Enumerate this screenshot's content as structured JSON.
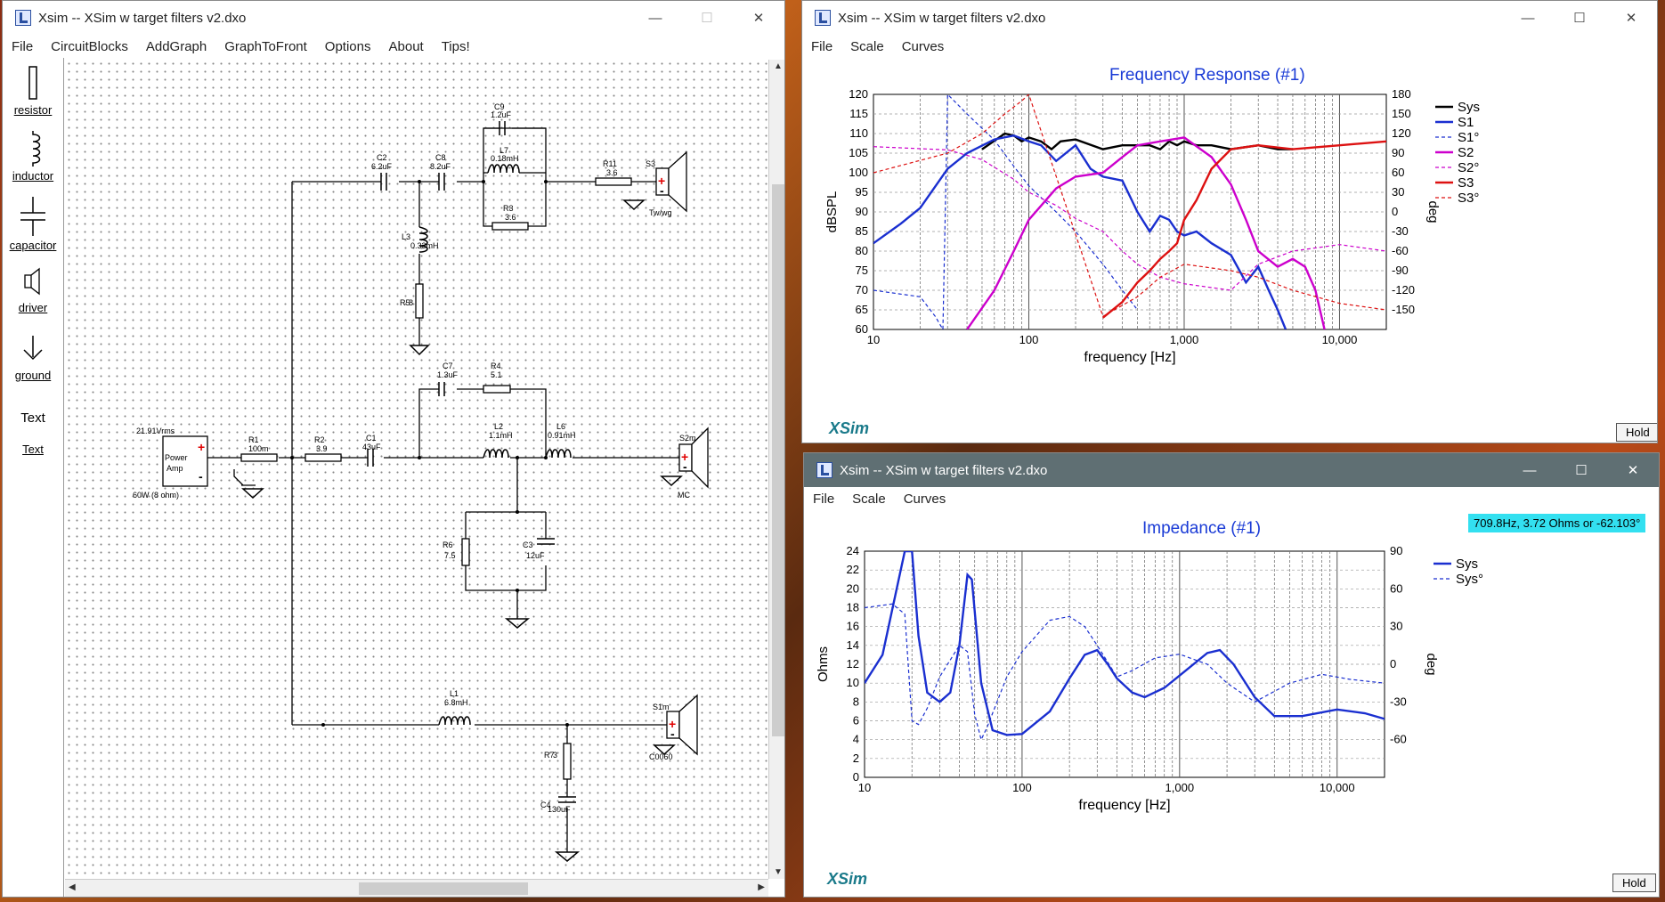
{
  "schematic_window": {
    "title": "Xsim -- XSim w target filters v2.dxo",
    "menu": [
      "File",
      "CircuitBlocks",
      "AddGraph",
      "GraphToFront",
      "Options",
      "About",
      "Tips!"
    ],
    "palette": [
      "resistor",
      "inductor",
      "capacitor",
      "driver",
      "ground",
      "Text",
      "Text"
    ],
    "components": {
      "src_v": "21.91Vrms",
      "src_l1": "Power",
      "src_l2": "Amp",
      "src_w": "60W (8 ohm)",
      "r1": "R1",
      "r1v": "100m",
      "r2": "R2",
      "r2v": "3.9",
      "c1": "C1",
      "c1v": "43uF",
      "c2": "C2",
      "c2v": "6.2uF",
      "c8": "C8",
      "c8v": "8.2uF",
      "c9": "C9",
      "c9v": "1.2uF",
      "l7": "L7",
      "l7v": "0.18mH",
      "r3": "R3",
      "r3v": "3.6",
      "r11": "R11",
      "r11v": "3.6",
      "s3": "S3",
      "s3v": "Tw/wg",
      "l3": "L3",
      "l3v": "0.33mH",
      "r5": "R5",
      "r5v": "8",
      "c7": "C7",
      "c7v": "1.3uF",
      "r4": "R4",
      "r4v": "5.1",
      "l2": "L2",
      "l2v": "1.1mH",
      "l6": "L6",
      "l6v": "0.91mH",
      "s2": "S2m",
      "s2v": "MC",
      "r6": "R6",
      "r6v": "7.5",
      "c3": "C3",
      "c3v": "12uF",
      "l1": "L1",
      "l1v": "6.8mH",
      "s1": "S1m",
      "s1v": "C0060",
      "r7": "R7",
      "r7v": "3",
      "c4": "C4",
      "c4v": "130uF"
    }
  },
  "freq_window": {
    "title": "Xsim -- XSim w target filters v2.dxo",
    "menu": [
      "File",
      "Scale",
      "Curves"
    ],
    "plot_title": "Frequency Response (#1)",
    "brand": "XSim",
    "hold": "Hold"
  },
  "imp_window": {
    "title": "Xsim -- XSim w target filters v2.dxo",
    "menu": [
      "File",
      "Scale",
      "Curves"
    ],
    "plot_title": "Impedance (#1)",
    "readout": "709.8Hz, 3.72 Ohms or -62.103°",
    "brand": "XSim",
    "hold": "Hold"
  },
  "chart_data": [
    {
      "type": "line",
      "title": "Frequency Response (#1)",
      "xlabel": "frequency [Hz]",
      "ylabel": "dBSPL",
      "y2label": "deg",
      "x_scale": "log",
      "xlim": [
        10,
        20000
      ],
      "ylim": [
        60,
        120
      ],
      "y2lim": [
        -180,
        180
      ],
      "xticks": [
        "10",
        "100",
        "1,000",
        "10,000"
      ],
      "yticks": [
        60,
        65,
        70,
        75,
        80,
        85,
        90,
        95,
        100,
        105,
        110,
        115,
        120
      ],
      "y2ticks": [
        -150,
        -120,
        -90,
        -60,
        -30,
        0,
        30,
        60,
        90,
        120,
        150,
        180
      ],
      "grid": true,
      "legend_position": "right",
      "series": [
        {
          "name": "Sys",
          "color": "#000000",
          "style": "solid",
          "axis": "left",
          "x": [
            50,
            70,
            80,
            90,
            100,
            120,
            140,
            160,
            200,
            300,
            400,
            500,
            600,
            700,
            800,
            900,
            1000,
            1200,
            1500,
            2000,
            3000,
            4000,
            5000
          ],
          "y": [
            106,
            110,
            109.5,
            108,
            109,
            108,
            106,
            108,
            108.5,
            106,
            107,
            107,
            107,
            106,
            108,
            107,
            108,
            107,
            107,
            106,
            107,
            106,
            106
          ]
        },
        {
          "name": "S1",
          "color": "#1a2fd0",
          "style": "solid",
          "axis": "left",
          "x": [
            10,
            15,
            20,
            30,
            40,
            60,
            80,
            100,
            120,
            150,
            200,
            250,
            300,
            400,
            500,
            600,
            700,
            800,
            900,
            1000,
            1200,
            1500,
            2000,
            2500,
            3000,
            3500,
            4000,
            4500
          ],
          "y": [
            82,
            87,
            91,
            101,
            105,
            108.5,
            109.5,
            108,
            107,
            103,
            107,
            101,
            99,
            98,
            90,
            85,
            89,
            88,
            85,
            84,
            85,
            82,
            79,
            72,
            76,
            70,
            65,
            60
          ]
        },
        {
          "name": "S1°",
          "color": "#1a2fd0",
          "style": "dashed",
          "axis": "right",
          "x": [
            10,
            20,
            25,
            28,
            30,
            40,
            60,
            80,
            100,
            150,
            200,
            300,
            400,
            500
          ],
          "y": [
            -120,
            -130,
            -160,
            -180,
            180,
            150,
            110,
            70,
            40,
            0,
            -30,
            -80,
            -120,
            -150
          ]
        },
        {
          "name": "S2",
          "color": "#cc00cc",
          "style": "solid",
          "axis": "left",
          "x": [
            40,
            60,
            80,
            100,
            150,
            200,
            300,
            400,
            500,
            700,
            1000,
            1500,
            2000,
            2500,
            3000,
            4000,
            5000,
            6000,
            7000,
            8000
          ],
          "y": [
            60,
            70,
            80,
            88,
            96,
            99,
            100,
            104,
            107,
            108,
            109,
            104,
            97,
            88,
            80,
            76,
            78,
            76,
            70,
            60
          ]
        },
        {
          "name": "S2°",
          "color": "#cc00cc",
          "style": "dashed",
          "axis": "right",
          "x": [
            10,
            30,
            50,
            80,
            100,
            150,
            200,
            300,
            400,
            500,
            700,
            1000,
            2000,
            3000,
            5000,
            10000,
            20000
          ],
          "y": [
            100,
            95,
            80,
            50,
            30,
            10,
            -10,
            -30,
            -60,
            -80,
            -100,
            -110,
            -120,
            -80,
            -60,
            -50,
            -60
          ]
        },
        {
          "name": "S3",
          "color": "#dd1111",
          "style": "solid",
          "axis": "left",
          "x": [
            300,
            400,
            500,
            600,
            700,
            800,
            900,
            1000,
            1200,
            1500,
            2000,
            3000,
            5000,
            10000,
            20000
          ],
          "y": [
            63,
            67,
            72,
            75,
            78,
            80,
            82,
            88,
            93,
            101,
            106,
            107,
            106,
            107,
            108
          ]
        },
        {
          "name": "S3°",
          "color": "#dd1111",
          "style": "dashed",
          "axis": "right",
          "x": [
            10,
            30,
            50,
            70,
            90,
            100,
            300,
            500,
            700,
            1000,
            2000,
            3000,
            5000,
            10000,
            20000
          ],
          "y": [
            60,
            90,
            120,
            150,
            170,
            180,
            -160,
            -130,
            -100,
            -80,
            -90,
            -100,
            -120,
            -140,
            -150
          ]
        }
      ]
    },
    {
      "type": "line",
      "title": "Impedance (#1)",
      "xlabel": "frequency [Hz]",
      "ylabel": "Ohms",
      "y2label": "deg",
      "x_scale": "log",
      "xlim": [
        10,
        20000
      ],
      "ylim": [
        0,
        24
      ],
      "y2lim": [
        -90,
        90
      ],
      "xticks": [
        "10",
        "100",
        "1,000",
        "10,000"
      ],
      "yticks": [
        0,
        2,
        4,
        6,
        8,
        10,
        12,
        14,
        16,
        18,
        20,
        22,
        24
      ],
      "y2ticks": [
        -60,
        -30,
        0,
        30,
        60,
        90
      ],
      "grid": true,
      "legend_position": "right",
      "series": [
        {
          "name": "Sys",
          "color": "#1a2fd0",
          "style": "solid",
          "axis": "left",
          "x": [
            10,
            13,
            16,
            18,
            20,
            22,
            25,
            30,
            35,
            40,
            45,
            48,
            55,
            65,
            80,
            100,
            150,
            200,
            250,
            300,
            350,
            400,
            500,
            600,
            800,
            1000,
            1500,
            1800,
            2200,
            3000,
            4000,
            6000,
            10000,
            15000,
            20000
          ],
          "y": [
            10,
            13,
            20,
            24,
            24,
            15,
            9,
            8,
            9,
            14,
            21.5,
            21,
            10,
            5,
            4.5,
            4.6,
            7,
            10.5,
            13,
            13.5,
            12,
            10.5,
            9,
            8.5,
            9.5,
            10.8,
            13.2,
            13.5,
            12,
            8.5,
            6.5,
            6.5,
            7.2,
            6.8,
            6.2
          ]
        },
        {
          "name": "Sys°",
          "color": "#1a2fd0",
          "style": "dashed",
          "axis": "right",
          "x": [
            10,
            15,
            18,
            20,
            22,
            25,
            30,
            40,
            45,
            50,
            55,
            60,
            80,
            100,
            150,
            200,
            250,
            300,
            400,
            500,
            700,
            1000,
            1500,
            2000,
            3000,
            5000,
            8000,
            12000,
            20000
          ],
          "y": [
            45,
            48,
            40,
            -45,
            -48,
            -35,
            -10,
            15,
            10,
            -40,
            -60,
            -50,
            -10,
            10,
            35,
            38,
            30,
            15,
            -10,
            -5,
            5,
            8,
            0,
            -15,
            -30,
            -15,
            -8,
            -12,
            -15
          ]
        }
      ]
    }
  ]
}
